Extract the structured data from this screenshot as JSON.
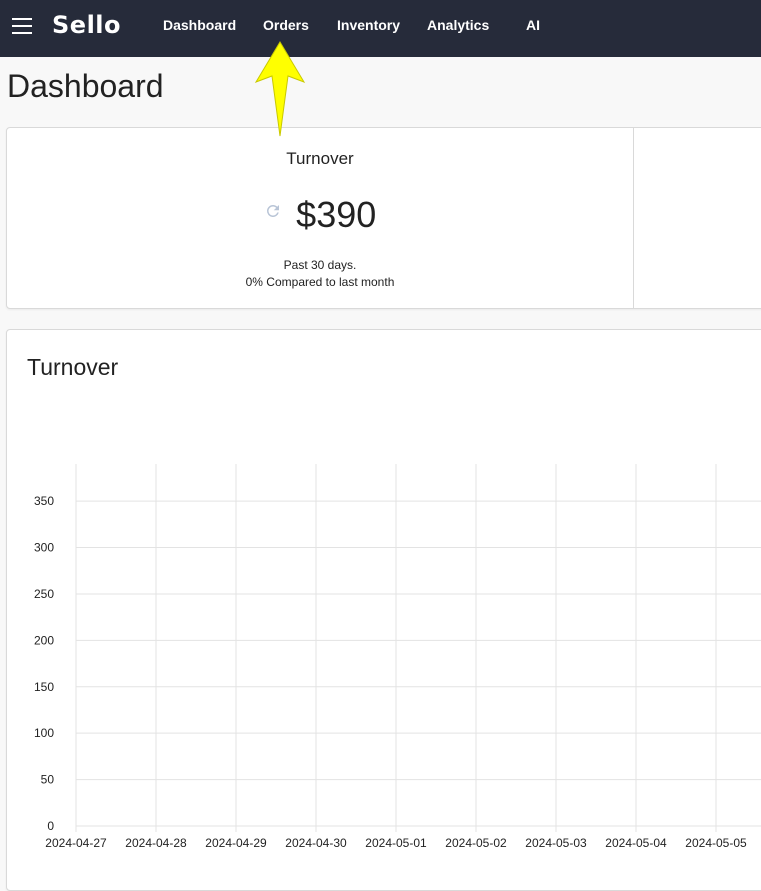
{
  "app": {
    "logo_text": "Sello"
  },
  "nav": {
    "items": [
      {
        "label": "Dashboard"
      },
      {
        "label": "Orders"
      },
      {
        "label": "Inventory"
      },
      {
        "label": "Analytics"
      },
      {
        "label": "AI"
      }
    ]
  },
  "page": {
    "title": "Dashboard"
  },
  "kpi": {
    "title": "Turnover",
    "value": "$390",
    "period": "Past 30 days.",
    "comparison": "0% Compared to last month",
    "icon": "refresh-icon"
  },
  "chart": {
    "title": "Turnover"
  },
  "chart_data": {
    "type": "line",
    "title": "Turnover",
    "x": [
      "2024-04-27",
      "2024-04-28",
      "2024-04-29",
      "2024-04-30",
      "2024-05-01",
      "2024-05-02",
      "2024-05-03",
      "2024-05-04",
      "2024-05-05"
    ],
    "y_ticks": [
      0,
      50,
      100,
      150,
      200,
      250,
      300,
      350
    ],
    "ylim": [
      0,
      390
    ],
    "series": [],
    "grid": true,
    "xlabel": "",
    "ylabel": ""
  },
  "colors": {
    "topbar": "#262b3a",
    "arrow_annotation": "#ffff00",
    "grid": "#e3e3e3"
  }
}
